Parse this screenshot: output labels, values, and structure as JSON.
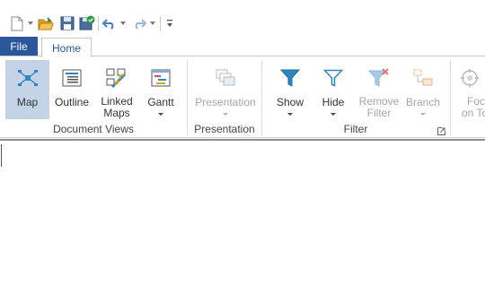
{
  "qat": {
    "icons": [
      "new-document-icon",
      "open-folder-icon",
      "save-icon",
      "undo-icon",
      "redo-icon",
      "customize-icon"
    ]
  },
  "tabs": {
    "file": "File",
    "home": "Home"
  },
  "ribbon": {
    "document_views": {
      "label": "Document Views",
      "map": "Map",
      "outline": "Outline",
      "linked_maps_1": "Linked",
      "linked_maps_2": "Maps",
      "gantt": "Gantt"
    },
    "presentation": {
      "label": "Presentation",
      "presentation": "Presentation"
    },
    "filter": {
      "label": "Filter",
      "show": "Show",
      "hide": "Hide",
      "remove_filter_1": "Remove",
      "remove_filter_2": "Filter",
      "branch": "Branch"
    },
    "focus": {
      "line1": "Foc",
      "line2": "on To"
    }
  },
  "colors": {
    "file_tab": "#2b579a",
    "active_button": "#c5d3e8",
    "icon_blue": "#2e86c1",
    "disabled_text": "#a6a6a6"
  }
}
